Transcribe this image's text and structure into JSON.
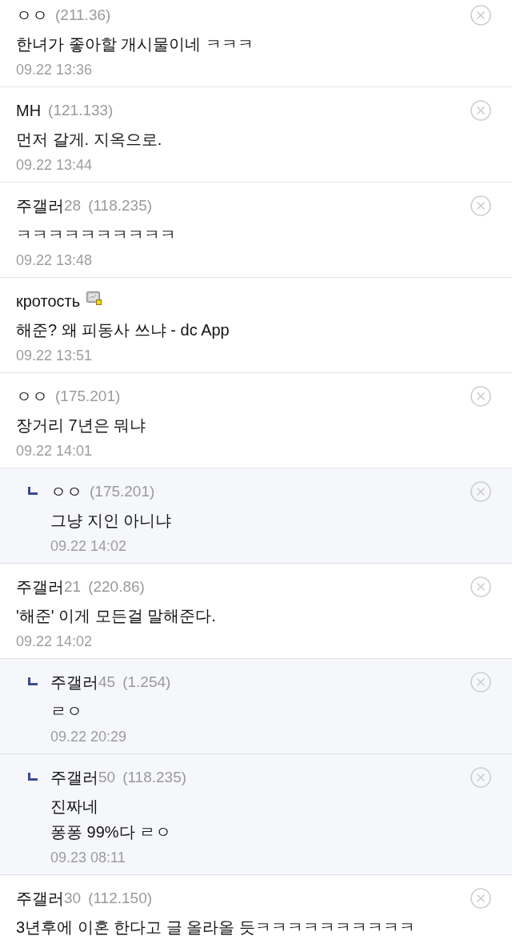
{
  "comments": [
    {
      "nickname": "ㅇㅇ",
      "ip": "(211.36)",
      "nick_icon": false,
      "text": "한녀가 좋아할 개시물이네 ㅋㅋㅋ",
      "date": "09.22 13:36",
      "deletable": true
    },
    {
      "nickname": "MH",
      "ip": "(121.133)",
      "nick_icon": false,
      "text": "먼저 갈게. 지옥으로.",
      "date": "09.22 13:44",
      "deletable": true
    },
    {
      "nickname": "주갤러",
      "nick_number": "28",
      "ip": "(118.235)",
      "nick_icon": false,
      "text": "ㅋㅋㅋㅋㅋㅋㅋㅋㅋㅋ",
      "date": "09.22 13:48",
      "deletable": true
    },
    {
      "nickname": "кротость",
      "nick_icon": true,
      "text": "해준? 왜 피동사 쓰냐 - dc App",
      "date": "09.22 13:51",
      "deletable": false
    },
    {
      "nickname": "ㅇㅇ",
      "ip": "(175.201)",
      "nick_icon": false,
      "text": "장거리 7년은 뭐냐",
      "date": "09.22 14:01",
      "deletable": true,
      "children": [
        {
          "nickname": "ㅇㅇ",
          "ip": "(175.201)",
          "nick_icon": false,
          "text": "그냥 지인 아니냐",
          "date": "09.22 14:02",
          "deletable": true
        }
      ]
    },
    {
      "nickname": "주갤러",
      "nick_number": "21",
      "ip": "(220.86)",
      "nick_icon": false,
      "text": "'해준' 이게 모든걸 말해준다.",
      "date": "09.22 14:02",
      "deletable": true,
      "children": [
        {
          "nickname": "주갤러",
          "nick_number": "45",
          "ip": "(1.254)",
          "nick_icon": false,
          "text": "ㄹㅇ",
          "date": "09.22 20:29",
          "deletable": true
        },
        {
          "nickname": "주갤러",
          "nick_number": "50",
          "ip": "(118.235)",
          "nick_icon": false,
          "text": "진짜네\n퐁퐁 99%다 ㄹㅇ",
          "date": "09.23 08:11",
          "deletable": true
        }
      ]
    },
    {
      "nickname": "주갤러",
      "nick_number": "30",
      "ip": "(112.150)",
      "nick_icon": false,
      "text": "3년후에 이혼 한다고 글 올라올 듯ㅋㅋㅋㅋㅋㅋㅋㅋㅋㅋ",
      "deletable": true
    }
  ]
}
